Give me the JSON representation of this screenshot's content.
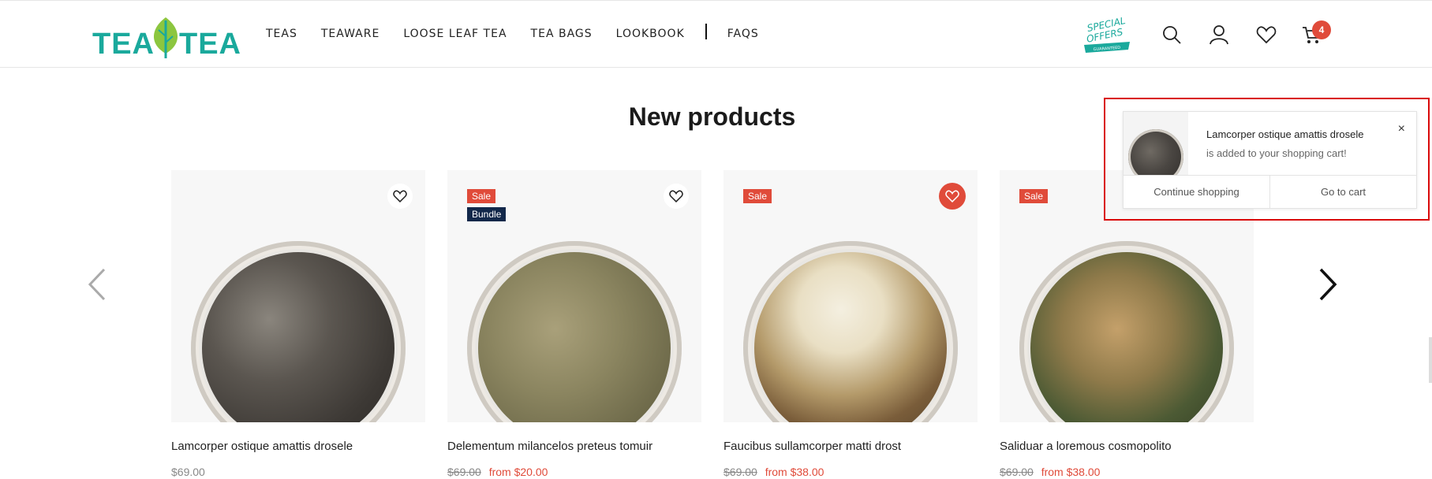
{
  "brand": {
    "logo_text_left": "TEA",
    "logo_text_right": "TEA",
    "accent": "#1aa99c"
  },
  "nav": {
    "items": [
      "TEAS",
      "TEAWARE",
      "LOOSE LEAF TEA",
      "TEA BAGS",
      "LOOKBOOK"
    ],
    "after_divider": "FAQS"
  },
  "header_icons": {
    "special_offer": {
      "line1": "SPECIAL",
      "line2": "OFFERS",
      "ribbon": "GUARANTEED"
    },
    "search": "search-icon",
    "account": "user-icon",
    "wishlist": "heart-icon",
    "cart": "cart-icon",
    "cart_count": "4"
  },
  "section": {
    "title": "New products"
  },
  "products": [
    {
      "name": "Lamcorper ostique amattis drosele",
      "price": "$69.00",
      "old_price": "",
      "badges": [],
      "wishlisted": false,
      "tea": "gunpowder"
    },
    {
      "name": "Delementum milancelos preteus tomuir",
      "price": "from $20.00",
      "old_price": "$69.00",
      "badges": [
        "Sale",
        "Bundle"
      ],
      "wishlisted": false,
      "tea": "mint"
    },
    {
      "name": "Faucibus sullamcorper matti drost",
      "price": "from $38.00",
      "old_price": "$69.00",
      "badges": [
        "Sale"
      ],
      "wishlisted": true,
      "tea": "chrysanthemum"
    },
    {
      "name": "Saliduar a loremous cosmopolito",
      "price": "from $38.00",
      "old_price": "$69.00",
      "badges": [
        "Sale"
      ],
      "wishlisted": false,
      "tea": "genmaicha"
    }
  ],
  "toast": {
    "product_name": "Lamcorper ostique amattis drosele",
    "message": "is added to your shopping cart!",
    "continue_label": "Continue shopping",
    "cart_label": "Go to cart",
    "close_symbol": "×"
  },
  "colors": {
    "sale": "#e04b3a",
    "bundle": "#12284a",
    "highlight_frame": "#d90a0a"
  }
}
